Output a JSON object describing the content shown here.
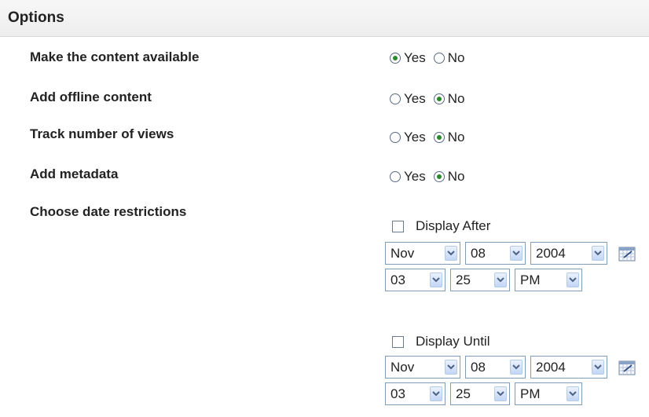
{
  "header": {
    "title": "Options"
  },
  "options": [
    {
      "label": "Make the content available",
      "yes": "Yes",
      "no": "No",
      "selected": "yes"
    },
    {
      "label": "Add offline content",
      "yes": "Yes",
      "no": "No",
      "selected": "no"
    },
    {
      "label": "Track number of views",
      "yes": "Yes",
      "no": "No",
      "selected": "no"
    },
    {
      "label": "Add metadata",
      "yes": "Yes",
      "no": "No",
      "selected": "no"
    }
  ],
  "date_restrictions": {
    "label": "Choose date restrictions",
    "after": {
      "label": "Display After",
      "checked": false,
      "month": "Nov",
      "day": "08",
      "year": "2004",
      "hour": "03",
      "minute": "25",
      "ampm": "PM"
    },
    "until": {
      "label": "Display Until",
      "checked": false,
      "month": "Nov",
      "day": "08",
      "year": "2004",
      "hour": "03",
      "minute": "25",
      "ampm": "PM"
    }
  },
  "icons": {
    "calendar": "calendar-icon",
    "dropdown": "chevron-down-icon"
  },
  "colors": {
    "radio_dot": "#2a8a2a",
    "select_border": "#7f9db9",
    "header_bg": "#eeeeee"
  }
}
